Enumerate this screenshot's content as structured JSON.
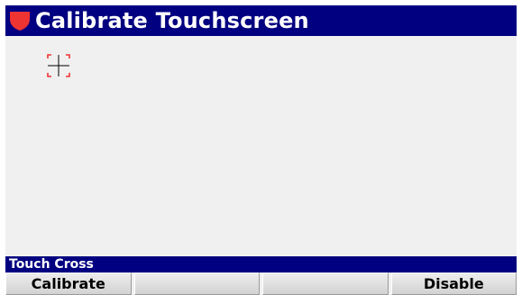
{
  "title": "Calibrate Touchscreen",
  "title_icon": "shield-icon",
  "status": "Touch Cross",
  "touch_target_icon": "crosshair-icon",
  "softkeys": [
    {
      "label": "Calibrate"
    },
    {
      "label": ""
    },
    {
      "label": ""
    },
    {
      "label": "Disable"
    }
  ],
  "colors": {
    "title_bar": "#000080",
    "status_bar": "#000080",
    "accent_red": "#ee3333",
    "background": "#f0f0f0"
  }
}
